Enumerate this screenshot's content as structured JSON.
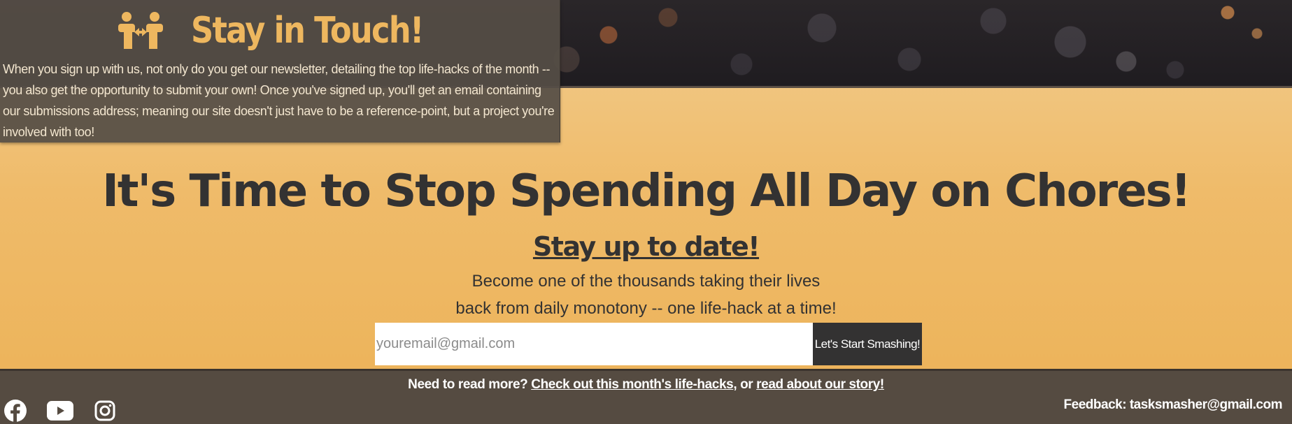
{
  "colors": {
    "accent": "#eeb75f",
    "dark_text": "#333232",
    "panel": "#554b41",
    "button": "#333232"
  },
  "touch": {
    "icon": "people-arrows-icon",
    "title": "Stay in Touch!",
    "body": "When you sign up with us, not only do you get our newsletter, detailing the top life-hacks of the month -- you also get the opportunity to submit your own! Once you've signed up, you'll get an email containing our submissions address; meaning our site doesn't just have to be a reference-point, but a project you're involved with too!"
  },
  "main": {
    "headline": "It's Time to Stop Spending All Day on Chores!",
    "subhead": "Stay up to date!",
    "tagline_line1": "Become one of the thousands taking their lives",
    "tagline_line2": "back from daily monotony -- one life-hack at a time!"
  },
  "signup": {
    "email_placeholder": "youremail@gmail.com",
    "email_value": "",
    "submit_label": "Let's Start Smashing!"
  },
  "footer": {
    "links_prefix": "Need to read more?",
    "link_lifehacks": "Check out this month's life-hacks",
    "links_joiner": ", or",
    "link_story": "read about our story!",
    "social": [
      {
        "name": "facebook-icon"
      },
      {
        "name": "youtube-icon"
      },
      {
        "name": "instagram-icon"
      }
    ],
    "feedback_label": "Feedback:",
    "feedback_email": "tasksmasher@gmail.com"
  }
}
